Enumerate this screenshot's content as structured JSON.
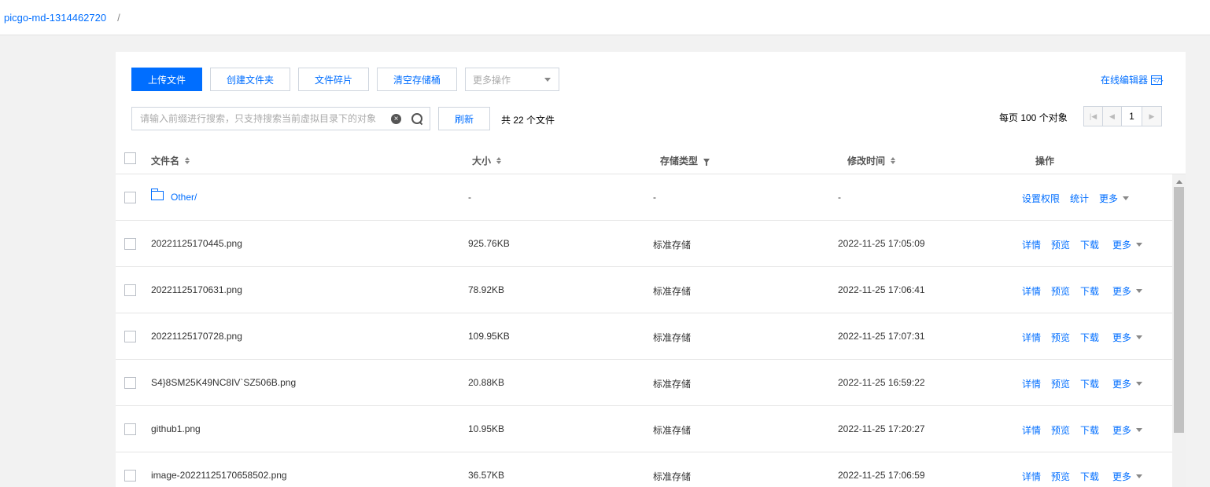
{
  "breadcrumb": {
    "bucket": "picgo-md-1314462720",
    "separator": "/"
  },
  "toolbar": {
    "upload": "上传文件",
    "create_folder": "创建文件夹",
    "fragments": "文件碎片",
    "clear_bucket": "清空存储桶",
    "more_ops_placeholder": "更多操作",
    "online_editor": "在线编辑器"
  },
  "search": {
    "placeholder": "请输入前缀进行搜索，只支持搜索当前虚拟目录下的对象",
    "refresh": "刷新",
    "total": "共 22 个文件"
  },
  "pagination": {
    "per_page": "每页 100 个对象",
    "current_page": "1"
  },
  "table": {
    "headers": {
      "name": "文件名",
      "size": "大小",
      "storage_type": "存储类型",
      "modified": "修改时间",
      "actions": "操作"
    },
    "folder_row": {
      "name": "Other/",
      "size": "-",
      "storage_type": "-",
      "modified": "-",
      "actions": [
        "设置权限",
        "统计",
        "更多"
      ]
    },
    "file_actions": [
      "详情",
      "预览",
      "下载",
      "更多"
    ],
    "rows": [
      {
        "name": "20221125170445.png",
        "size": "925.76KB",
        "storage_type": "标准存储",
        "modified": "2022-11-25 17:05:09"
      },
      {
        "name": "20221125170631.png",
        "size": "78.92KB",
        "storage_type": "标准存储",
        "modified": "2022-11-25 17:06:41"
      },
      {
        "name": "20221125170728.png",
        "size": "109.95KB",
        "storage_type": "标准存储",
        "modified": "2022-11-25 17:07:31"
      },
      {
        "name": "S4}8SM25K49NC8IV`SZ506B.png",
        "size": "20.88KB",
        "storage_type": "标准存储",
        "modified": "2022-11-25 16:59:22"
      },
      {
        "name": "github1.png",
        "size": "10.95KB",
        "storage_type": "标准存储",
        "modified": "2022-11-25 17:20:27"
      },
      {
        "name": "image-20221125170658502.png",
        "size": "36.57KB",
        "storage_type": "标准存储",
        "modified": "2022-11-25 17:06:59"
      }
    ]
  },
  "colors": {
    "accent": "#006eff",
    "page_bg": "#f2f2f2"
  }
}
